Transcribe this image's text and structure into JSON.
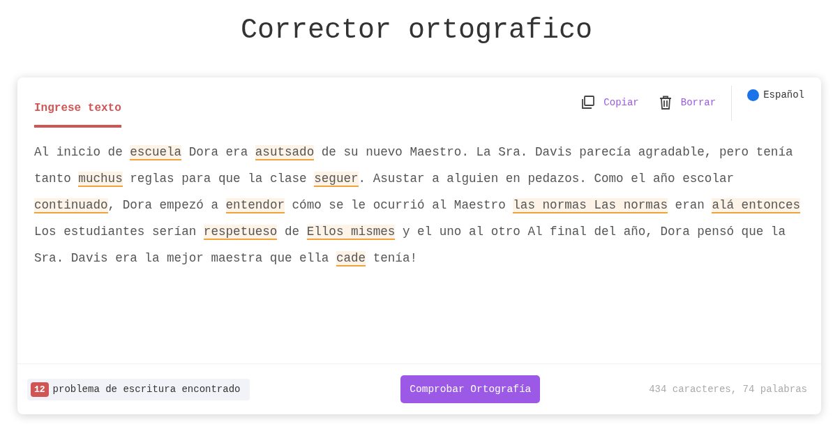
{
  "title": "Corrector ortografico",
  "tabs": [
    {
      "label": "Ingrese texto",
      "selected": true
    }
  ],
  "actions": [
    {
      "kind": "copy",
      "label": "Copiar"
    },
    {
      "kind": "delete",
      "label": "Borrar"
    }
  ],
  "language": {
    "label": "Español",
    "color": "#1a73e8"
  },
  "text": [
    {
      "text": "Al inicio de ",
      "error": false
    },
    {
      "text": "escuela",
      "error": true
    },
    {
      "text": " Dora era ",
      "error": false
    },
    {
      "text": "asutsado",
      "error": true
    },
    {
      "text": " de su nuevo Maestro. La Sra. Davis parecía agradable, pero tenía tanto ",
      "error": false
    },
    {
      "text": "muchus",
      "error": true
    },
    {
      "text": " reglas para que la clase ",
      "error": false
    },
    {
      "text": "seguer",
      "error": true
    },
    {
      "text": ". Asustar a alguien en pedazos. Como el año escolar ",
      "error": false
    },
    {
      "text": "continuado",
      "error": true
    },
    {
      "text": ", Dora empezó a ",
      "error": false
    },
    {
      "text": "entendor",
      "error": true
    },
    {
      "text": " cómo se le ocurrió al Maestro ",
      "error": false
    },
    {
      "text": "las normas Las normas",
      "error": true
    },
    {
      "text": " eran ",
      "error": false
    },
    {
      "text": "alá entonces",
      "error": true
    },
    {
      "text": " Los estudiantes serían ",
      "error": false
    },
    {
      "text": "respetueso",
      "error": true
    },
    {
      "text": " de ",
      "error": false
    },
    {
      "text": "Ellos mismes",
      "error": true
    },
    {
      "text": " y el uno al otro Al final del año, Dora pensó que la Sra. Davis era la mejor maestra que ella ",
      "error": false
    },
    {
      "text": "cade",
      "error": true
    },
    {
      "text": " tenía!",
      "error": false
    }
  ],
  "footer": {
    "problem_count": "12",
    "problem_label": "problema de escritura encontrado",
    "check_button": "Comprobar Ortografía",
    "stats": "434 caracteres, 74 palabras"
  }
}
